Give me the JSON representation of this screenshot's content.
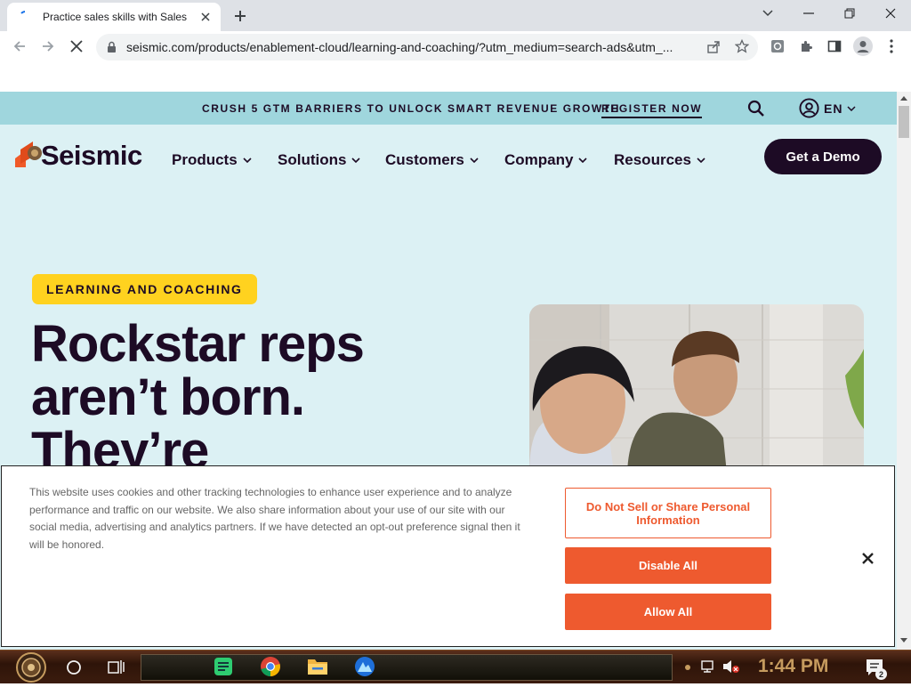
{
  "browser": {
    "tab_title": "Practice sales skills with Sales",
    "url": "seismic.com/products/enablement-cloud/learning-and-coaching/?utm_medium=search-ads&utm_..."
  },
  "page": {
    "banner_text": "CRUSH 5 GTM BARRIERS TO UNLOCK SMART REVENUE GROWTH",
    "banner_link": "REGISTER NOW",
    "language": "EN",
    "logo_text": "Seismic",
    "nav_items": [
      "Products",
      "Solutions",
      "Customers",
      "Company",
      "Resources"
    ],
    "demo_button": "Get a Demo",
    "eyebrow": "LEARNING AND COACHING",
    "headline_lines": [
      "Rockstar reps",
      "aren’t born.",
      "They’re"
    ]
  },
  "cookie_banner": {
    "text": "This website uses cookies and other tracking technologies to enhance user experience and to analyze performance and traffic on our website. We also share information about your use of our site with our social media, advertising and analytics partners. If we have detected an opt-out preference signal then it will be honored.",
    "do_not_sell_button": "Do Not Sell or Share Personal Information",
    "disable_all_button": "Disable All",
    "allow_all_button": "Allow All"
  },
  "taskbar": {
    "clock": "1:44 PM",
    "notification_count": "2"
  },
  "colors": {
    "brand_dark": "#1d0b25",
    "banner_bg": "#9fd6dd",
    "hero_bg": "#dcf1f4",
    "eyebrow_yellow": "#ffd21f",
    "cookie_orange": "#ee5a2f"
  }
}
